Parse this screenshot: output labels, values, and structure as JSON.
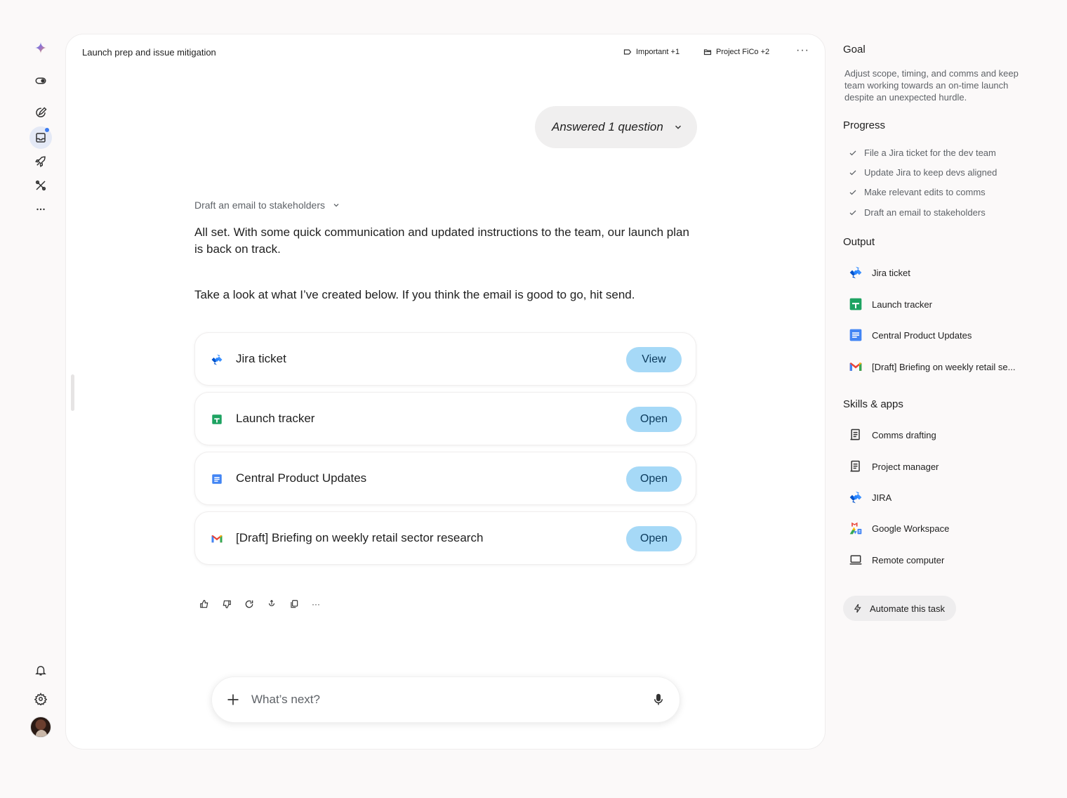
{
  "rail": {
    "items": [
      "gemini-logo-icon",
      "toggle-icon",
      "new-task-icon",
      "inbox-icon",
      "rocket-icon",
      "tools-icon",
      "more-icon",
      "bell-icon",
      "settings-icon"
    ]
  },
  "header": {
    "title": "Launch prep and issue mitigation",
    "label_chip": "Important +1",
    "folder_chip": "Project FiCo +2",
    "more": "···"
  },
  "conversation": {
    "answered": "Answered 1 question",
    "step": "Draft an email to stakeholders",
    "message1": "All set. With some quick communication and updated instructions to the team, our launch plan is back on track.",
    "message2": "Take a look at what I’ve created below. If you think the email is good to go, hit send.",
    "cards": [
      {
        "label": "Jira ticket",
        "button": "View",
        "icon": "jira-icon"
      },
      {
        "label": "Launch tracker",
        "button": "Open",
        "icon": "sheets-icon"
      },
      {
        "label": "Central Product Updates",
        "button": "Open",
        "icon": "docs-icon"
      },
      {
        "label": "[Draft] Briefing on weekly retail sector research",
        "button": "Open",
        "icon": "gmail-icon"
      }
    ],
    "actions": [
      "thumbs-up-icon",
      "thumbs-down-icon",
      "regenerate-icon",
      "share-icon",
      "copy-icon",
      "more-icon"
    ],
    "more": "···"
  },
  "composer": {
    "placeholder": "What’s next?"
  },
  "sidebar": {
    "goal_title": "Goal",
    "goal_text": "Adjust scope, timing, and comms and keep team working towards an on-time launch despite an unexpected hurdle.",
    "progress_title": "Progress",
    "progress": [
      "File a Jira ticket for the dev team",
      "Update Jira to keep devs aligned",
      "Make relevant edits to comms",
      "Draft an email to stakeholders"
    ],
    "output_title": "Output",
    "outputs": [
      {
        "label": "Jira ticket",
        "icon": "jira-icon"
      },
      {
        "label": "Launch tracker",
        "icon": "sheets-icon"
      },
      {
        "label": "Central Product Updates",
        "icon": "docs-icon"
      },
      {
        "label": "[Draft] Briefing on weekly retail se...",
        "icon": "gmail-icon"
      }
    ],
    "skills_title": "Skills & apps",
    "skills": [
      {
        "label": "Comms drafting",
        "icon": "scroll-icon"
      },
      {
        "label": "Project manager",
        "icon": "scroll-icon"
      },
      {
        "label": "JIRA",
        "icon": "jira-icon"
      },
      {
        "label": "Google Workspace",
        "icon": "workspace-icon"
      },
      {
        "label": "Remote computer",
        "icon": "laptop-icon"
      }
    ],
    "automate": "Automate this task"
  },
  "colors": {
    "accent_button": "#a6d9f7",
    "jira_blue": "#2684ff",
    "sheets_green": "#1ea362",
    "docs_blue": "#4285f4"
  }
}
